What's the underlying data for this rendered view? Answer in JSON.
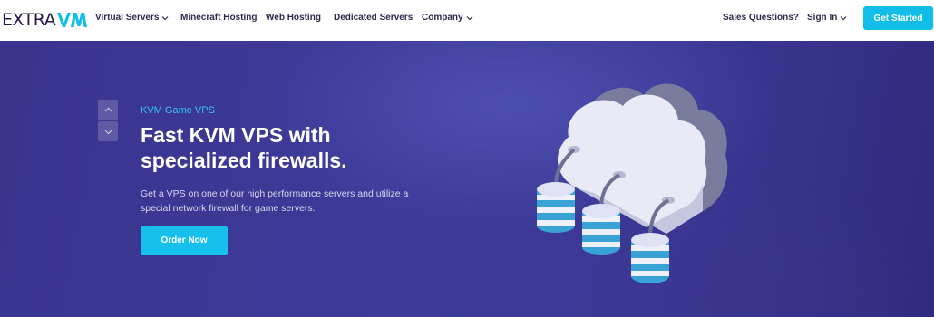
{
  "brand": {
    "logo_text": "EXTRA",
    "logo_mark_name": "vm-logo-mark"
  },
  "nav": {
    "items": [
      {
        "label": "Virtual Servers",
        "has_dropdown": true
      },
      {
        "label": "Minecraft Hosting",
        "has_dropdown": false
      },
      {
        "label": "Web Hosting",
        "has_dropdown": false
      },
      {
        "label": "Dedicated Servers",
        "has_dropdown": false
      },
      {
        "label": "Company",
        "has_dropdown": true
      }
    ],
    "sales": "Sales Questions?",
    "sign_in": "Sign In",
    "cta": "Get Started"
  },
  "hero": {
    "eyebrow": "KVM Game VPS",
    "headline": "Fast KVM VPS with specialized firewalls.",
    "description": "Get a VPS on one of our high performance servers and utilize a special network firewall for game servers.",
    "button": "Order Now",
    "illustration": "cloud-database-illustration"
  },
  "colors": {
    "brand_navy": "#1f1c4a",
    "accent_cyan": "#12bde8",
    "hero_bg": "#3b3895",
    "eyebrow": "#34c6f0"
  }
}
